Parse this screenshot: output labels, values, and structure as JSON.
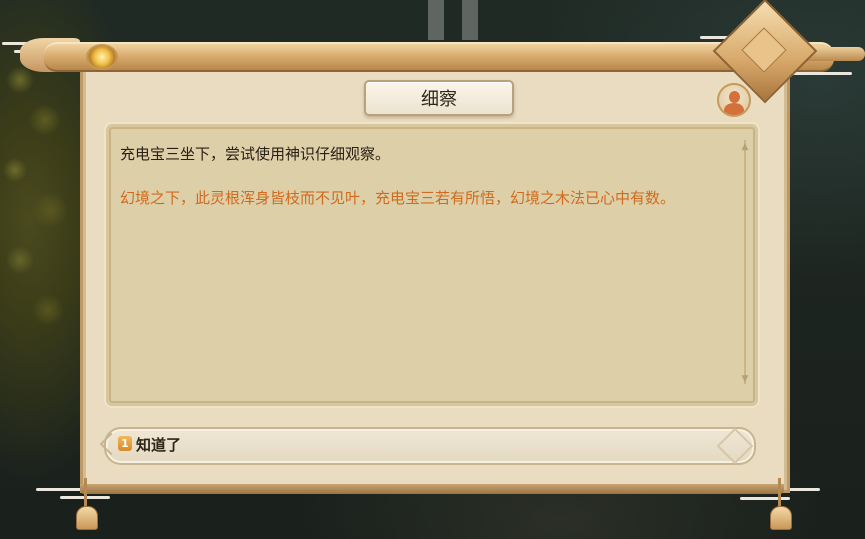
{
  "dialog": {
    "title": "细察",
    "narration": "充电宝三坐下，尝试使用神识仔细观察。",
    "result": "幻境之下，此灵根浑身皆枝而不见叶，充电宝三若有所悟，幻境之木法已心中有数。",
    "choices": [
      {
        "number": "1",
        "label": "知道了"
      }
    ]
  },
  "icons": {
    "avatar": "character-portrait-icon",
    "scroll_up": "scroll-up-arrow-icon",
    "scroll_down": "scroll-down-arrow-icon"
  },
  "colors": {
    "narration": "#2a2016",
    "result": "#d06b1e",
    "parchment": "#e9dcc0",
    "frame": "#bd9866"
  }
}
